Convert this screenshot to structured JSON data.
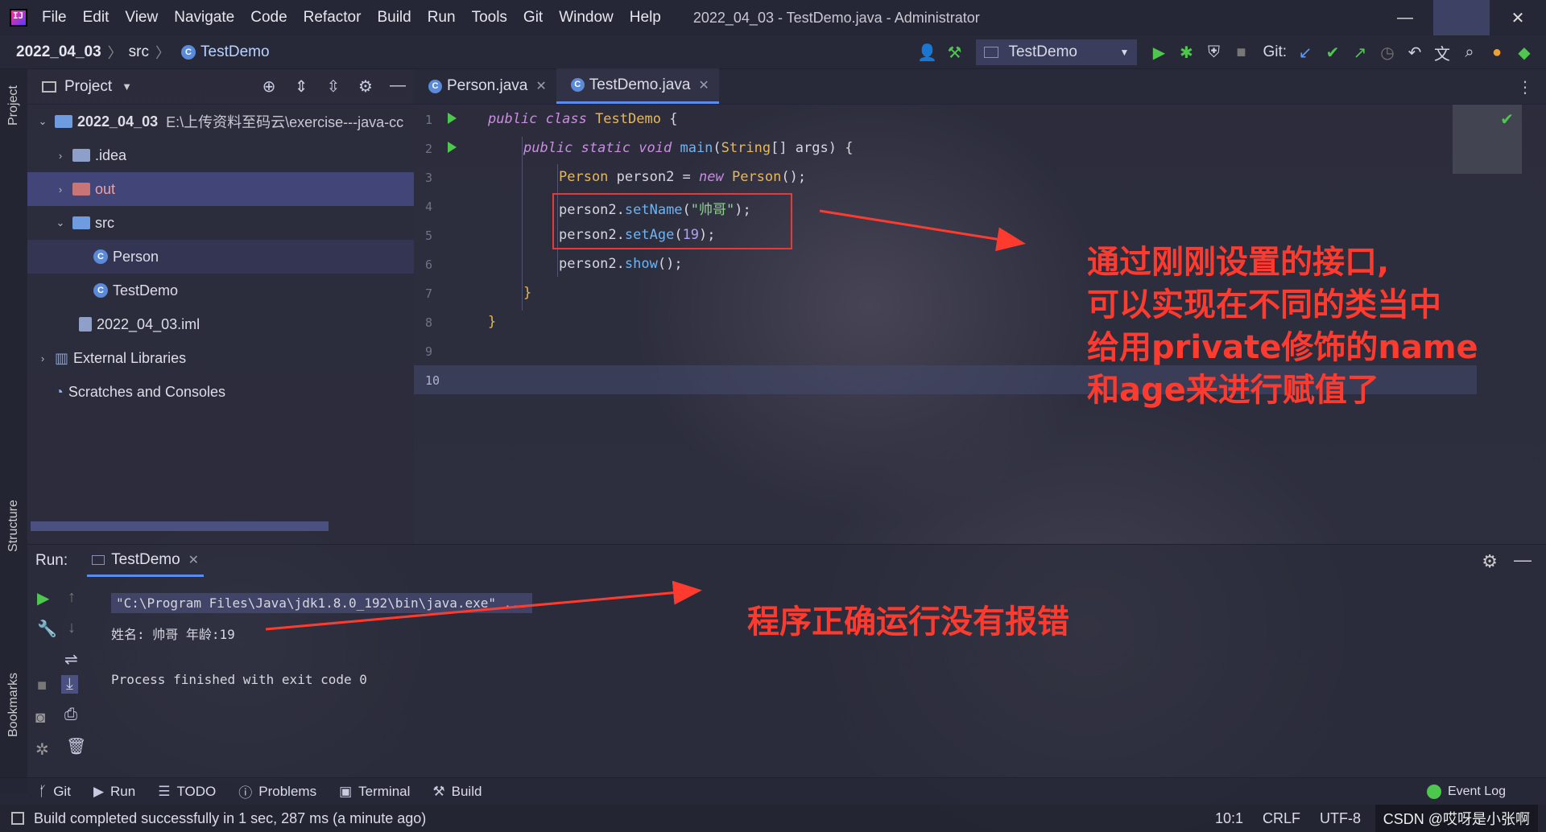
{
  "window": {
    "app_icon": "intellij-idea-icon",
    "menu": [
      "File",
      "Edit",
      "View",
      "Navigate",
      "Code",
      "Refactor",
      "Build",
      "Run",
      "Tools",
      "Git",
      "Window",
      "Help"
    ],
    "title": "2022_04_03 - TestDemo.java - Administrator",
    "controls": {
      "minimize": "—",
      "maximize": "",
      "close": "✕"
    }
  },
  "breadcrumb": {
    "project": "2022_04_03",
    "folder": "src",
    "file": "TestDemo"
  },
  "toolbar": {
    "run_config": "TestDemo",
    "git_label": "Git:"
  },
  "project_panel": {
    "title": "Project",
    "tree": [
      {
        "label": "2022_04_03",
        "path": "E:\\上传资料至码云\\exercise---java-cc",
        "type": "project"
      },
      {
        "label": ".idea",
        "type": "folder"
      },
      {
        "label": "out",
        "type": "folder"
      },
      {
        "label": "src",
        "type": "folder"
      },
      {
        "label": "Person",
        "type": "class"
      },
      {
        "label": "TestDemo",
        "type": "class"
      },
      {
        "label": "2022_04_03.iml",
        "type": "file"
      },
      {
        "label": "External Libraries",
        "type": "library"
      },
      {
        "label": "Scratches and Consoles",
        "type": "scratch"
      }
    ]
  },
  "editor": {
    "tabs": [
      {
        "label": "Person.java",
        "active": false
      },
      {
        "label": "TestDemo.java",
        "active": true
      }
    ],
    "line_numbers": [
      "1",
      "2",
      "3",
      "4",
      "5",
      "6",
      "7",
      "8",
      "9",
      "10"
    ],
    "code": {
      "l1_kw": "public class ",
      "l1_name": "TestDemo",
      "l1_rest": " {",
      "l2_kw": "public static void ",
      "l2_fn": "main",
      "l2_rest_a": "(",
      "l2_type": "String",
      "l2_rest_b": "[] args) {",
      "l3_type": "Person",
      "l3_a": " person2 = ",
      "l3_new": "new ",
      "l3_ctor": "Person",
      "l3_b": "();",
      "l4_obj": "person2.",
      "l4_fn": "setName",
      "l4_a": "(",
      "l4_str": "\"帅哥\"",
      "l4_b": ");",
      "l5_obj": "person2.",
      "l5_fn": "setAge",
      "l5_a": "(",
      "l5_num": "19",
      "l5_b": ");",
      "l6_obj": "person2.",
      "l6_fn": "show",
      "l6_b": "();",
      "l7": "}",
      "l8": "}"
    },
    "annotation_lines": [
      "通过刚刚设置的接口,",
      "可以实现在不同的类当中",
      "给用private修饰的name",
      "和age来进行赋值了"
    ]
  },
  "run_panel": {
    "label": "Run:",
    "tab": "TestDemo",
    "command": "\"C:\\Program Files\\Java\\jdk1.8.0_192\\bin\\java.exe\" ...",
    "output": "姓名: 帅哥 年龄:19",
    "exit": "Process finished with exit code 0",
    "annotation": "程序正确运行没有报错"
  },
  "bottom_tools": [
    "Git",
    "Run",
    "TODO",
    "Problems",
    "Terminal",
    "Build"
  ],
  "event_log": "Event Log",
  "side_labels": {
    "project": "Project",
    "structure": "Structure",
    "bookmarks": "Bookmarks"
  },
  "status": {
    "message": "Build completed successfully in 1 sec, 287 ms (a minute ago)",
    "position": "10:1",
    "line_sep": "CRLF",
    "encoding": "UTF-8",
    "watermark": "CSDN @哎呀是小张啊"
  },
  "colors": {
    "accent": "#5c8bf0",
    "annotation": "#ff3b30",
    "run_green": "#4ec74e"
  }
}
